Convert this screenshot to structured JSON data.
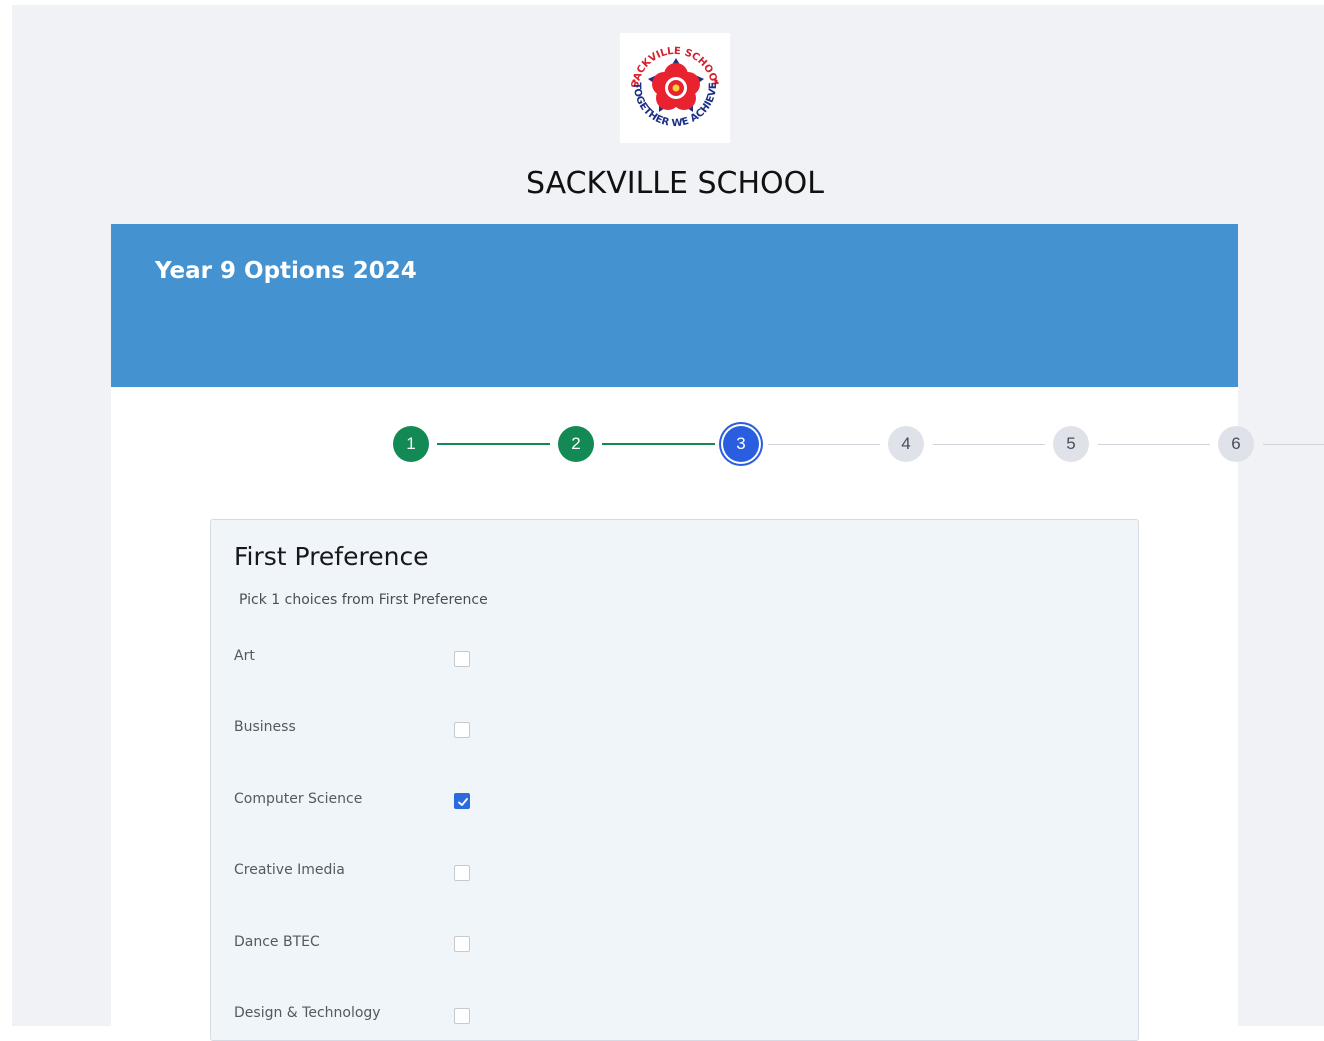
{
  "school": {
    "name": "SACKVILLE SCHOOL",
    "logo_top_text": "SACKVILLE SCHOOL",
    "logo_bottom_text": "TOGETHER WE ACHIEVE"
  },
  "form": {
    "title": "Year 9 Options 2024"
  },
  "stepper": {
    "steps": [
      {
        "label": "1",
        "state": "done"
      },
      {
        "label": "2",
        "state": "done"
      },
      {
        "label": "3",
        "state": "current"
      },
      {
        "label": "4",
        "state": "todo"
      },
      {
        "label": "5",
        "state": "todo"
      },
      {
        "label": "6",
        "state": "todo"
      }
    ]
  },
  "section": {
    "title": "First Preference",
    "subtitle": "Pick 1 choices from First Preference",
    "options": [
      {
        "label": "Art",
        "checked": false
      },
      {
        "label": "Business",
        "checked": false
      },
      {
        "label": "Computer Science",
        "checked": true
      },
      {
        "label": "Creative Imedia",
        "checked": false
      },
      {
        "label": "Dance BTEC",
        "checked": false
      },
      {
        "label": "Design & Technology",
        "checked": false
      }
    ]
  },
  "colors": {
    "banner": "#4592d0",
    "step_done": "#138a55",
    "step_current": "#2a5ee0",
    "checkbox_checked": "#2a6be0"
  }
}
